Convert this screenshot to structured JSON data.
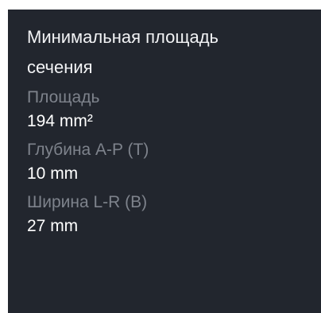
{
  "panel": {
    "title_line1": "Минимальная площадь",
    "title_line2": "сечения",
    "metrics": [
      {
        "label": "Площадь",
        "value": "194 mm²"
      },
      {
        "label": "Глубина A-P (T)",
        "value": "10 mm"
      },
      {
        "label": "Ширина L-R (B)",
        "value": "27 mm"
      }
    ]
  }
}
